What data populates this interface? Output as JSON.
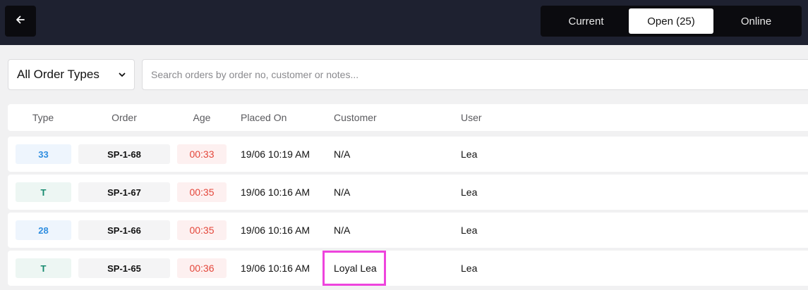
{
  "header": {
    "back_icon": "arrow-left-icon",
    "tabs": [
      {
        "label": "Current"
      },
      {
        "label": "Open (25)",
        "active": true
      },
      {
        "label": "Online"
      }
    ]
  },
  "filters": {
    "order_type_selected": "All Order Types",
    "search_placeholder": "Search orders by order no, customer or notes..."
  },
  "table": {
    "columns": [
      "Type",
      "Order",
      "Age",
      "Placed On",
      "Customer",
      "User"
    ],
    "rows": [
      {
        "type": "33",
        "order": "SP-1-68",
        "age": "00:33",
        "placed_on": "19/06 10:19 AM",
        "customer": "N/A",
        "user": "Lea"
      },
      {
        "type": "T",
        "order": "SP-1-67",
        "age": "00:35",
        "placed_on": "19/06 10:16 AM",
        "customer": "N/A",
        "user": "Lea"
      },
      {
        "type": "28",
        "order": "SP-1-66",
        "age": "00:35",
        "placed_on": "19/06 10:16 AM",
        "customer": "N/A",
        "user": "Lea"
      },
      {
        "type": "T",
        "order": "SP-1-65",
        "age": "00:36",
        "placed_on": "19/06 10:16 AM",
        "customer": "Loyal Lea",
        "user": "Lea"
      }
    ]
  },
  "colors": {
    "header_bg": "#1e2130",
    "age_red": "#e4463a",
    "type_blue": "#2f8ee0",
    "type_teal": "#178a6f",
    "highlight": "#ee44dd"
  }
}
